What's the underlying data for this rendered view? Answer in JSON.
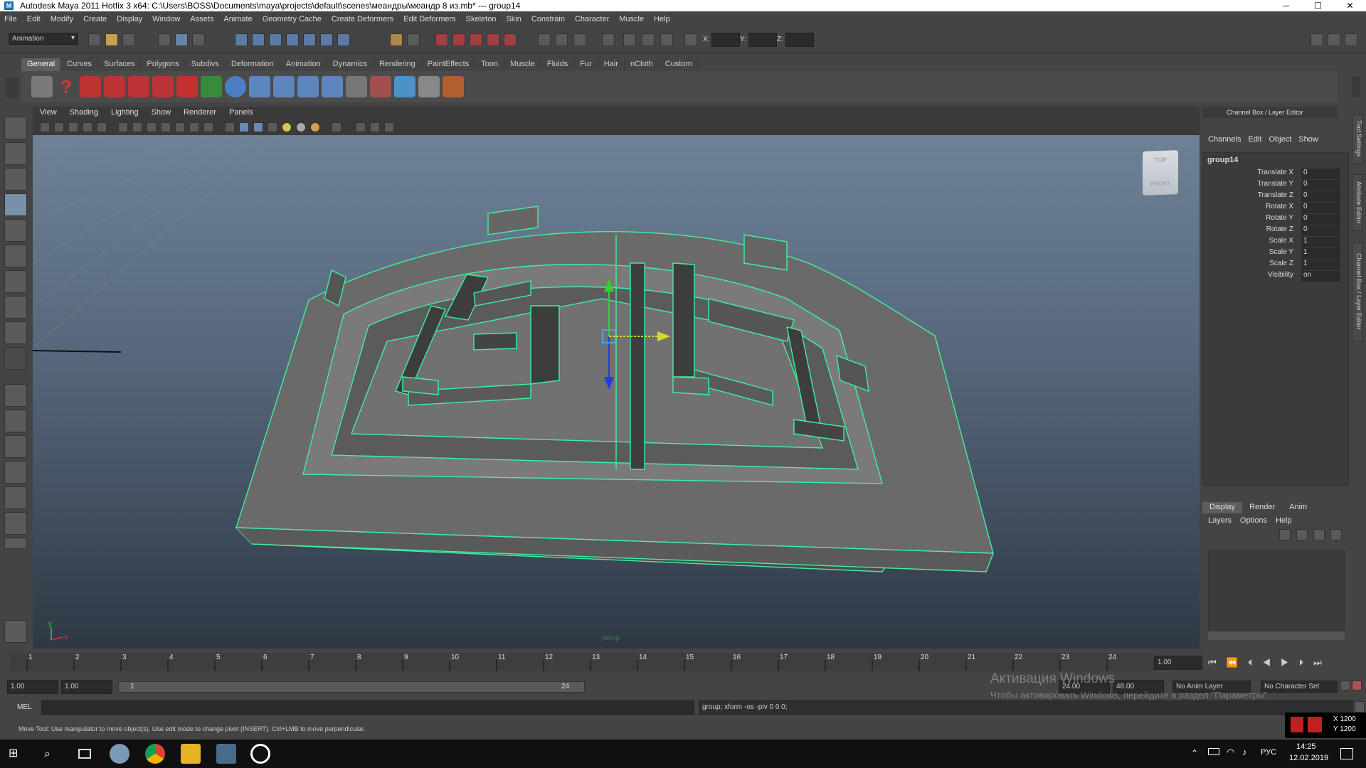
{
  "window": {
    "title": "Autodesk Maya 2011 Hotfix 3 x64: C:\\Users\\BOSS\\Documents\\maya\\projects\\default\\scenes\\меандры\\меандр 8 из.mb*   ---   group14",
    "minimize": "─",
    "maximize": "☐",
    "close": "✕"
  },
  "menubar": [
    "File",
    "Edit",
    "Modify",
    "Create",
    "Display",
    "Window",
    "Assets",
    "Animate",
    "Geometry Cache",
    "Create Deformers",
    "Edit Deformers",
    "Skeleton",
    "Skin",
    "Constrain",
    "Character",
    "Muscle",
    "Help"
  ],
  "statusline": {
    "menu_set": "Animation",
    "x_label": "X:",
    "y_label": "Y:",
    "z_label": "Z:"
  },
  "shelf_tabs": [
    "General",
    "Curves",
    "Surfaces",
    "Polygons",
    "Subdivs",
    "Deformation",
    "Animation",
    "Dynamics",
    "Rendering",
    "PaintEffects",
    "Toon",
    "Muscle",
    "Fluids",
    "Fur",
    "Hair",
    "nCloth",
    "Custom"
  ],
  "shelf_active": "General",
  "panel_menu": [
    "View",
    "Shading",
    "Lighting",
    "Show",
    "Renderer",
    "Panels"
  ],
  "viewcube": {
    "top": "TOP",
    "front": "FRONT"
  },
  "viewport": {
    "camera": "persp",
    "axis_x": "x",
    "axis_y": "y"
  },
  "channelbox": {
    "header": "Channel Box / Layer Editor",
    "menus": [
      "Channels",
      "Edit",
      "Object",
      "Show"
    ],
    "object": "group14",
    "channels": [
      {
        "label": "Translate X",
        "value": "0"
      },
      {
        "label": "Translate Y",
        "value": "0"
      },
      {
        "label": "Translate Z",
        "value": "0"
      },
      {
        "label": "Rotate X",
        "value": "0"
      },
      {
        "label": "Rotate Y",
        "value": "0"
      },
      {
        "label": "Rotate Z",
        "value": "0"
      },
      {
        "label": "Scale X",
        "value": "1"
      },
      {
        "label": "Scale Y",
        "value": "1"
      },
      {
        "label": "Scale Z",
        "value": "1"
      },
      {
        "label": "Visibility",
        "value": "on"
      }
    ]
  },
  "side_tabs": [
    "Tool Settings",
    "Attribute Editor",
    "Channel Box / Layer Editor"
  ],
  "layereditor": {
    "tabs": [
      "Display",
      "Render",
      "Anim"
    ],
    "menus": [
      "Layers",
      "Options",
      "Help"
    ]
  },
  "timeslider": {
    "ticks": [
      "1",
      "2",
      "3",
      "4",
      "5",
      "6",
      "7",
      "8",
      "9",
      "10",
      "11",
      "12",
      "13",
      "14",
      "15",
      "16",
      "17",
      "18",
      "19",
      "20",
      "21",
      "22",
      "23",
      "24"
    ],
    "current_time": "1.00"
  },
  "rangeslider": {
    "start": "1.00",
    "playback_start": "1.00",
    "range_start": "1",
    "range_end": "24",
    "playback_end": "24.00",
    "end": "48.00",
    "anim_layer": "No Anim Layer",
    "character_set": "No Character Set"
  },
  "cmdline": {
    "label": "MEL",
    "result": "group; xform -os -piv 0 0 0;"
  },
  "helpline": "Move Tool: Use manipulator to move object(s). Use edit mode to change pivot (INSERT).  Ctrl+LMB to move perpendicular.",
  "watermark": {
    "line1": "Активация Windows",
    "line2": "Чтобы активировать Windows, перейдите в раздел \"Параметры\"."
  },
  "coords": {
    "x": "X 1200",
    "y": "Y 1200"
  },
  "taskbar": {
    "lang": "РУС",
    "time": "14:25",
    "date": "12.02.2019"
  },
  "colors": {
    "wire": "#3ff0a0",
    "viewport_top": "#6e8196",
    "viewport_bottom": "#2e3845",
    "shelf_red": "#c03030"
  }
}
